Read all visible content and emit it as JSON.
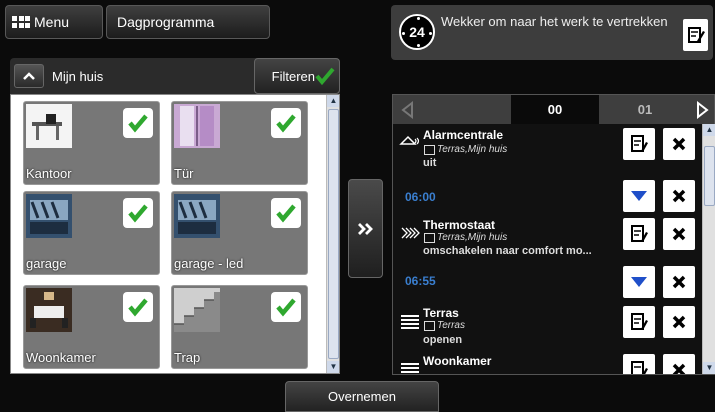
{
  "header": {
    "menu_label": "Menu",
    "dagprogramma_label": "Dagprogramma"
  },
  "alarm": {
    "clock_text": "24",
    "title": "Wekker om naar het werk te vertrekken"
  },
  "filter": {
    "group_label": "Mijn huis",
    "filter_label": "Filteren"
  },
  "rooms": [
    {
      "label": "Kantoor",
      "checked": true,
      "icon": "office-photo"
    },
    {
      "label": "Tür",
      "checked": true,
      "icon": "door-photo"
    },
    {
      "label": "garage",
      "checked": true,
      "icon": "garage-photo"
    },
    {
      "label": "garage - led",
      "checked": true,
      "icon": "garage-photo"
    },
    {
      "label": "Woonkamer",
      "checked": true,
      "icon": "livingroom-photo"
    },
    {
      "label": "Trap",
      "checked": true,
      "icon": "stairs-photo"
    }
  ],
  "hours": {
    "current": "00",
    "next": "01"
  },
  "program": [
    {
      "type": "item",
      "icon": "alarm-icon",
      "name": "Alarmcentrale",
      "location": "Terras,Mijn huis",
      "action": "uit"
    },
    {
      "type": "time",
      "time": "06:00"
    },
    {
      "type": "item",
      "icon": "thermostat-icon",
      "name": "Thermostaat",
      "location": "Terras,Mijn huis",
      "action": "omschakelen naar comfort mo..."
    },
    {
      "type": "time",
      "time": "06:55"
    },
    {
      "type": "item",
      "icon": "shutter-icon",
      "name": "Terras",
      "location": "Terras",
      "action": "openen"
    },
    {
      "type": "item",
      "icon": "shutter-icon",
      "name": "Woonkamer",
      "location": "",
      "action": ""
    }
  ],
  "footer": {
    "overnemen_label": "Overnemen"
  },
  "colors": {
    "check": "#2fa82f",
    "time_text": "#3a7fd0",
    "expand_arrow": "#1f4fc9"
  }
}
